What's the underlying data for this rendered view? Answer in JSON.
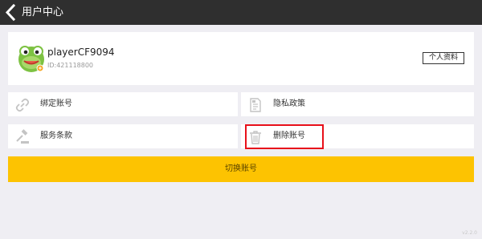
{
  "header": {
    "title": "用户中心",
    "back_icon": "chevron-left-icon"
  },
  "profile": {
    "username": "playerCF9094",
    "user_id": "ID:421118800",
    "profile_button": "个人资料",
    "avatar": "frog-avatar"
  },
  "menu": {
    "bind_account": {
      "label": "绑定账号",
      "icon": "link-icon"
    },
    "privacy_policy": {
      "label": "隐私政策",
      "icon": "document-icon"
    },
    "terms_of_service": {
      "label": "服务条款",
      "icon": "gavel-icon"
    },
    "delete_account": {
      "label": "删除账号",
      "icon": "trash-icon"
    }
  },
  "switch_account": {
    "label": "切换账号"
  },
  "footer": {
    "version": "v2.2.0"
  },
  "colors": {
    "header_bg": "#2f2f2f",
    "page_bg": "#efeef3",
    "accent_yellow": "#fdc301",
    "highlight_red": "#e8101a"
  }
}
